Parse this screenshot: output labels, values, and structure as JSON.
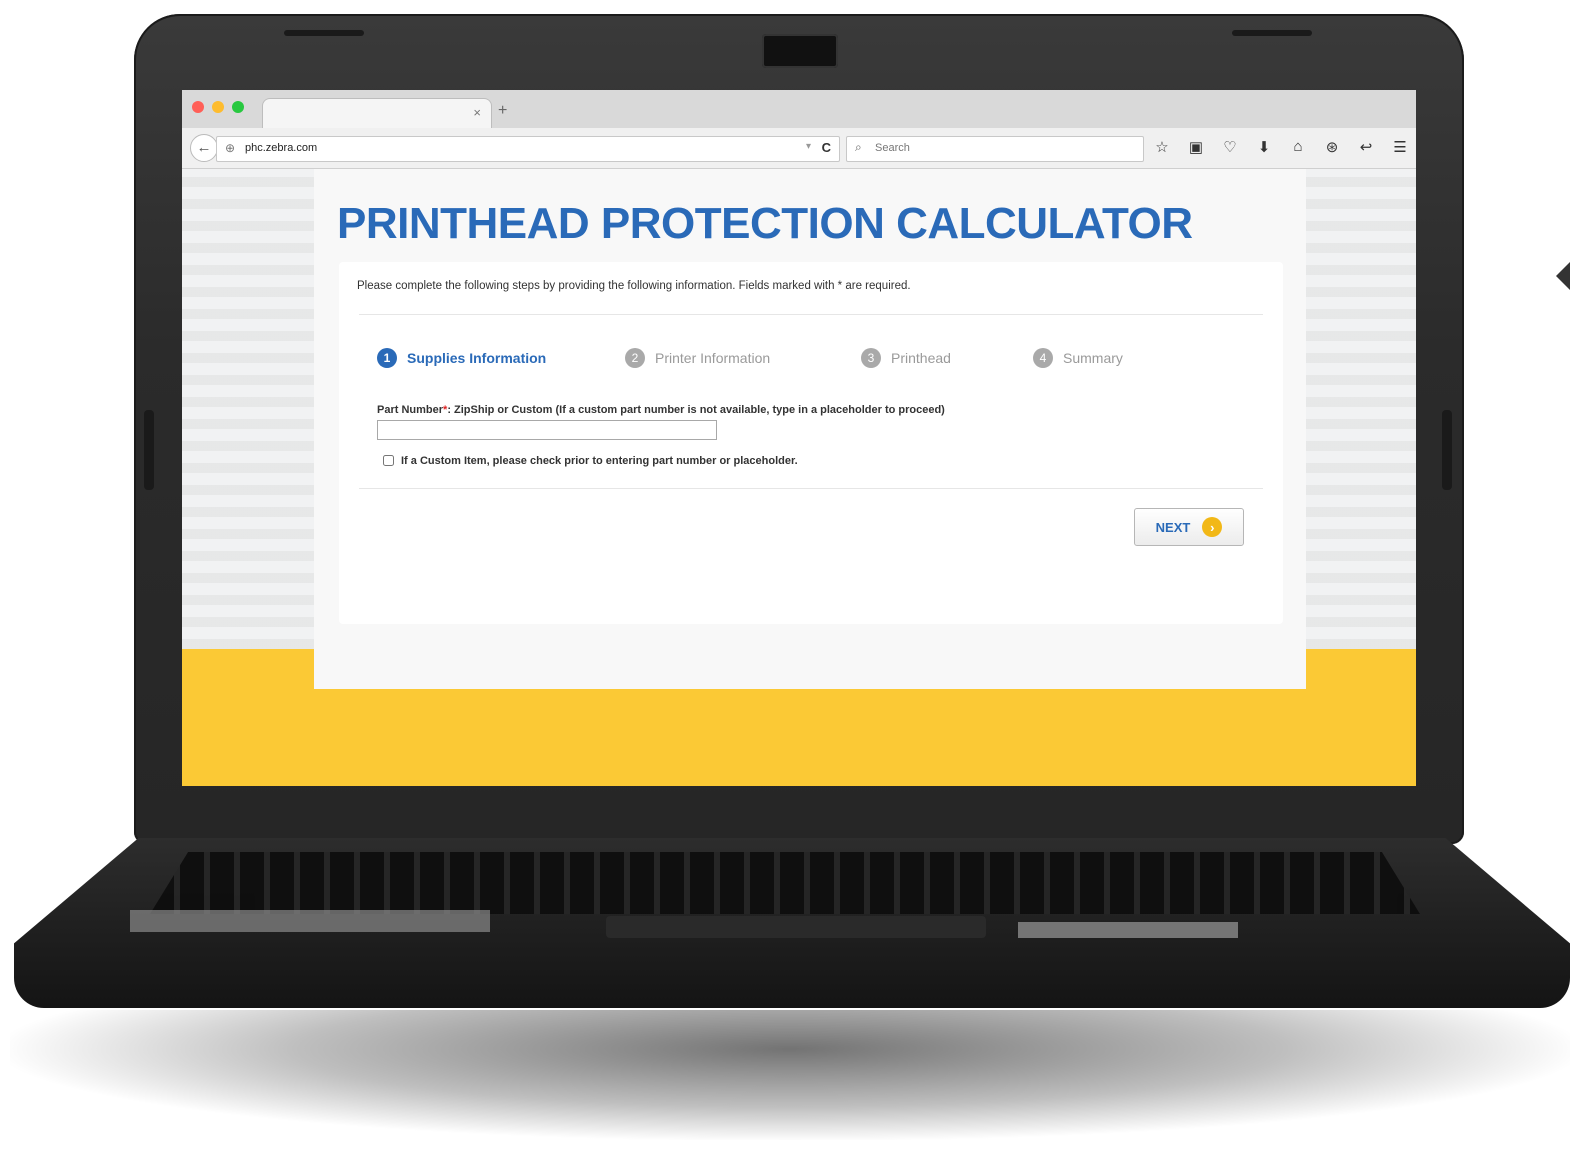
{
  "browser": {
    "tab_close": "×",
    "new_tab": "+",
    "back": "←",
    "url": "phc.zebra.com",
    "url_dropdown": "▾",
    "reload": "C",
    "search_placeholder": "Search",
    "toolbar_icons": [
      "star-icon",
      "clipboard-icon",
      "pocket-icon",
      "download-icon",
      "home-icon",
      "sync-icon",
      "share-icon",
      "menu-icon"
    ],
    "toolbar_glyphs": [
      "☆",
      "▣",
      "♡",
      "⬇",
      "⌂",
      "⊛",
      "↩",
      "☰"
    ],
    "traffic_lights": [
      "#ff5f57",
      "#febc2e",
      "#28c840"
    ]
  },
  "page": {
    "title": "PRINTHEAD PROTECTION CALCULATOR",
    "instructions": "Please complete the following steps by providing the following information. Fields marked with * are required.",
    "steps": [
      {
        "num": "1",
        "label": "Supplies Information",
        "active": true
      },
      {
        "num": "2",
        "label": "Printer Information",
        "active": false
      },
      {
        "num": "3",
        "label": "Printhead",
        "active": false
      },
      {
        "num": "4",
        "label": "Summary",
        "active": false
      }
    ],
    "part_number_label": "Part Number",
    "required_mark": "*",
    "part_number_hint": ": ZipShip or Custom (If a custom part number is not available, type in a placeholder to proceed)",
    "part_number_value": "",
    "custom_item_label": "If a Custom Item, please check prior to entering part number or placeholder.",
    "custom_item_checked": false,
    "next_label": "NEXT",
    "next_arrow": "›"
  },
  "colors": {
    "brand_blue": "#2a6ab8",
    "brand_yellow": "#fbc935"
  }
}
